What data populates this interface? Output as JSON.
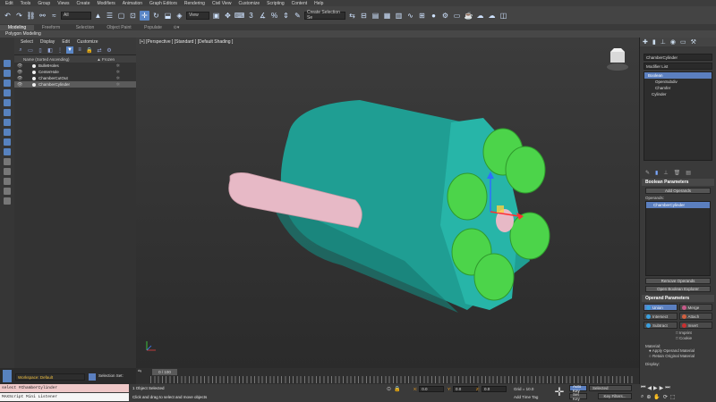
{
  "menu": [
    "Edit",
    "Tools",
    "Group",
    "Views",
    "Create",
    "Modifiers",
    "Animation",
    "Graph Editors",
    "Rendering",
    "Civil View",
    "Customize",
    "Scripting",
    "Content",
    "Help"
  ],
  "toolbar": {
    "filter_value": "All",
    "view_value": "View",
    "selection_set_value": "Create Selection Se"
  },
  "ribbon": {
    "tabs": [
      "Modeling",
      "Freeform",
      "Selection",
      "Object Paint",
      "Populate"
    ],
    "active_index": 0,
    "sub_label": "Polygon Modeling"
  },
  "explorer": {
    "menu": [
      "Select",
      "Display",
      "Edit",
      "Customize"
    ],
    "col_name": "Name (Sorted Ascending)",
    "col_frozen": "▲ Frozen",
    "rows": [
      {
        "name": "BulletHoles",
        "selected": false
      },
      {
        "name": "CenterHole",
        "selected": false
      },
      {
        "name": "ChamberCutOut",
        "selected": false
      },
      {
        "name": "ChamberCylinder",
        "selected": true
      }
    ]
  },
  "viewport": {
    "label": "[+] [Perspective ] [Standard ] [Default Shading ]"
  },
  "command_panel": {
    "object_name": "ChamberCylinder",
    "modifier_list": "Modifier List",
    "stack": [
      {
        "label": "Boolean",
        "type": "selected"
      },
      {
        "label": "OpenSubdiv",
        "type": "sub"
      },
      {
        "label": "Chamfer",
        "type": "sub"
      },
      {
        "label": "Cylinder",
        "type": "normal"
      }
    ],
    "boolean_title": "Boolean Parameters",
    "add_operands": "Add Operands",
    "operands_label": "Operands:",
    "operand": "ChamberCylinder",
    "remove_operands": "Remove Operands",
    "open_explorer": "Open Boolean Explorer",
    "operand_params_title": "Operand Parameters",
    "ops": [
      {
        "label": "Union",
        "active": true,
        "color": "#3aa0e0"
      },
      {
        "label": "Merge",
        "active": false,
        "color": "#c85a8a"
      },
      {
        "label": "Intersect",
        "active": false,
        "color": "#3aa0e0"
      },
      {
        "label": "Attach",
        "active": false,
        "color": "#d06040"
      },
      {
        "label": "Subtract",
        "active": false,
        "color": "#3aa0e0"
      },
      {
        "label": "Insert",
        "active": false,
        "color": "#c83030"
      }
    ],
    "imprint": "Imprint",
    "cookie": "Cookie",
    "material_label": "Material:",
    "apply_material": "Apply Operand Material",
    "retain_material": "Retain Original Material",
    "display_label": "Display:"
  },
  "timeline": {
    "frame": "0 / 100"
  },
  "status": {
    "workspace": "Workspace: Default",
    "selection_set": "Selection Set:",
    "maxscript_line1": "select #ChamberCylinder",
    "maxscript_line2": "MAXScript Mini Listener",
    "objects_selected": "1 Object Selected",
    "hint": "Click and drag to select and move objects",
    "x": "0.0",
    "y": "0.0",
    "z": "0.0",
    "grid": "Grid = 10.0",
    "add_time_tag": "Add Time Tag",
    "auto_key": "Auto Key",
    "selected_value": "Selected",
    "set_key": "Set Key",
    "key_filters": "Key Filters..."
  },
  "colors": {
    "teal": "#27b5a8",
    "green": "#4cd44a",
    "pink": "#e7b9c6",
    "accent": "#5b7fbf"
  }
}
